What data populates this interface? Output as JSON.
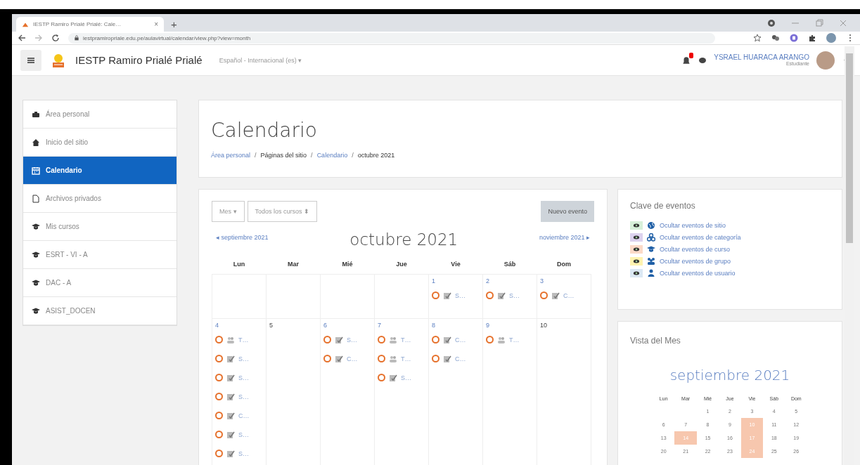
{
  "browser": {
    "tab_title": "IESTP Ramiro Prialé Prialé: Cale…",
    "tab_close": "×",
    "new_tab": "+",
    "url": "iestpramiroprialе.edu.pe/aulavirtual/calendar/view.php?view=month"
  },
  "navbar": {
    "site_name": "IESTP Ramiro Prialé Prialé",
    "language": "Español - Internacional (es) ▾",
    "user_name": "YSRAEL HUARACA ARANGO",
    "user_role": "Estudiante"
  },
  "sidebar": {
    "items": [
      {
        "label": "Área personal",
        "kind": "dashboard",
        "selected": false
      },
      {
        "label": "Inicio del sitio",
        "kind": "home",
        "selected": false
      },
      {
        "label": "Calendario",
        "kind": "calendar",
        "selected": true
      },
      {
        "label": "Archivos privados",
        "kind": "file",
        "selected": false
      },
      {
        "label": "Mis cursos",
        "kind": "course",
        "selected": false
      },
      {
        "label": "ESRT - VI - A",
        "kind": "course",
        "selected": false
      },
      {
        "label": "DAC - A",
        "kind": "course",
        "selected": false
      },
      {
        "label": "ASIST_DOCEN",
        "kind": "course",
        "selected": false
      }
    ]
  },
  "header": {
    "title": "Calendario",
    "breadcrumb": [
      {
        "label": "Área personal",
        "link": true
      },
      {
        "separator": "/",
        "label": "Páginas del sitio",
        "link": false
      },
      {
        "separator": "/",
        "label": "Calendario",
        "link": true
      },
      {
        "separator": "/",
        "label": "octubre 2021",
        "link": false
      }
    ]
  },
  "calendar": {
    "view_select": "Mes ▾",
    "course_select": "Todos los cursos ⬍",
    "new_event_button": "Nuevo evento",
    "prev_month": "◂ septiembre 2021",
    "month": "octubre 2021",
    "next_month": "noviembre 2021 ▸",
    "weekdays": [
      "Lun",
      "Mar",
      "Mié",
      "Jue",
      "Vie",
      "Sáb",
      "Dom"
    ],
    "weeks": [
      [
        {
          "kind": "blank"
        },
        {
          "kind": "blank"
        },
        {
          "kind": "blank"
        },
        {
          "kind": "blank"
        },
        {
          "kind": "day",
          "day": "1",
          "events": [
            {
              "kind": "assign",
              "title": "S…"
            }
          ]
        },
        {
          "kind": "day",
          "day": "2",
          "events": [
            {
              "kind": "assign",
              "title": "S…"
            }
          ]
        },
        {
          "kind": "day",
          "day": "3",
          "events": [
            {
              "kind": "assign",
              "title": "C…"
            }
          ]
        }
      ],
      [
        {
          "kind": "day",
          "day": "4",
          "events": [
            {
              "kind": "forum",
              "title": "T…"
            },
            {
              "kind": "assign",
              "title": "S…"
            },
            {
              "kind": "assign",
              "title": "S…"
            },
            {
              "kind": "assign",
              "title": "S…"
            },
            {
              "kind": "assign",
              "title": "C…"
            },
            {
              "kind": "assign",
              "title": "S…"
            },
            {
              "kind": "assign",
              "title": "S…"
            }
          ]
        },
        {
          "kind": "day",
          "day": "5"
        },
        {
          "kind": "day",
          "day": "6",
          "events": [
            {
              "kind": "assign",
              "title": "S…"
            },
            {
              "kind": "assign",
              "title": "C…"
            }
          ]
        },
        {
          "kind": "day",
          "day": "7",
          "events": [
            {
              "kind": "forum",
              "title": "T…"
            },
            {
              "kind": "forum",
              "title": "T…"
            },
            {
              "kind": "assign",
              "title": "S…"
            }
          ]
        },
        {
          "kind": "day",
          "day": "8",
          "events": [
            {
              "kind": "assign",
              "title": "C…"
            },
            {
              "kind": "assign",
              "title": "C…"
            }
          ]
        },
        {
          "kind": "day",
          "day": "9",
          "events": [
            {
              "kind": "forum",
              "title": "T…"
            }
          ]
        },
        {
          "kind": "day",
          "day": "10"
        }
      ]
    ]
  },
  "event_key": {
    "title": "Clave de eventos",
    "items": [
      {
        "label": "Ocultar eventos de sitio",
        "kind": "site",
        "color": "#d7f0d9"
      },
      {
        "label": "Ocultar eventos de categoría",
        "kind": "category",
        "color": "#dcd2ee"
      },
      {
        "label": "Ocultar eventos de curso",
        "kind": "course",
        "color": "#fbdac8"
      },
      {
        "label": "Ocultar eventos de grupo",
        "kind": "group",
        "color": "#fff3b0"
      },
      {
        "label": "Ocultar eventos de usuario",
        "kind": "user",
        "color": "#dbe8f4"
      }
    ]
  },
  "month_view": {
    "title": "Vista del Mes",
    "month": "septiembre 2021",
    "weekdays": [
      "Lun",
      "Mar",
      "Mié",
      "Jue",
      "Vie",
      "Sáb",
      "Dom"
    ],
    "weeks": [
      [
        {
          "kind": "blank"
        },
        {
          "kind": "blank"
        },
        {
          "kind": "day",
          "day": "1",
          "has_events": false
        },
        {
          "kind": "day",
          "day": "2",
          "has_events": false
        },
        {
          "kind": "day",
          "day": "3",
          "has_events": false
        },
        {
          "kind": "day",
          "day": "4",
          "has_events": false
        },
        {
          "kind": "day",
          "day": "5",
          "has_events": false
        }
      ],
      [
        {
          "kind": "day",
          "day": "6",
          "has_events": false
        },
        {
          "kind": "day",
          "day": "7",
          "has_events": false
        },
        {
          "kind": "day",
          "day": "8",
          "has_events": false
        },
        {
          "kind": "day",
          "day": "9",
          "has_events": false
        },
        {
          "kind": "day",
          "day": "10",
          "has_events": true
        },
        {
          "kind": "day",
          "day": "11",
          "has_events": false
        },
        {
          "kind": "day",
          "day": "12",
          "has_events": false
        }
      ],
      [
        {
          "kind": "day",
          "day": "13",
          "has_events": false
        },
        {
          "kind": "day",
          "day": "14",
          "has_events": true
        },
        {
          "kind": "day",
          "day": "15",
          "has_events": false
        },
        {
          "kind": "day",
          "day": "16",
          "has_events": false
        },
        {
          "kind": "day",
          "day": "17",
          "has_events": true
        },
        {
          "kind": "day",
          "day": "18",
          "has_events": false
        },
        {
          "kind": "day",
          "day": "19",
          "has_events": false
        }
      ],
      [
        {
          "kind": "day",
          "day": "20",
          "has_events": false
        },
        {
          "kind": "day",
          "day": "21",
          "has_events": false
        },
        {
          "kind": "day",
          "day": "22",
          "has_events": false
        },
        {
          "kind": "day",
          "day": "23",
          "has_events": false
        },
        {
          "kind": "day",
          "day": "24",
          "has_events": true
        },
        {
          "kind": "day",
          "day": "25",
          "has_events": false
        },
        {
          "kind": "day",
          "day": "26",
          "has_events": false
        }
      ]
    ]
  }
}
